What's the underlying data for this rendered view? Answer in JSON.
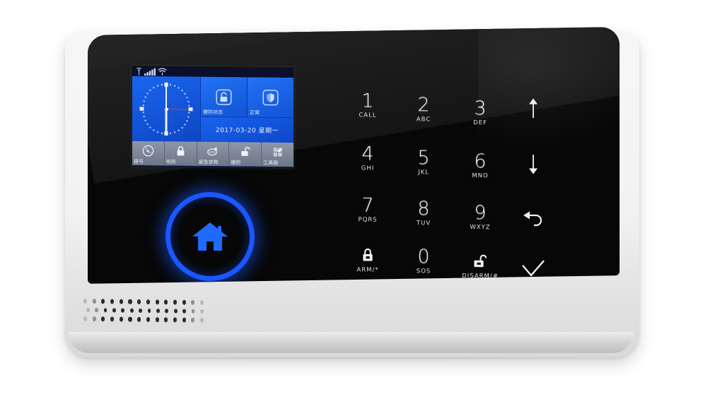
{
  "device": {
    "name": "wireless-alarm-panel",
    "colors": {
      "glass": "#070707",
      "body": "#f2f2f2",
      "accent_blue": "#1a57ff",
      "lcd_blue": "#1358e8",
      "lcd_toolbar": "#7b8496"
    }
  },
  "lcd": {
    "status_bar": {
      "antenna_icon": "antenna-icon",
      "signal_icon": "signal-bars-icon",
      "wifi_icon": "wifi-icon"
    },
    "clock": {
      "icon": "analog-clock",
      "hour_hand": "6",
      "minute_hand": "12"
    },
    "tiles": [
      {
        "icon": "unlocked-padlock-icon",
        "label": "撤防状态"
      },
      {
        "icon": "shield-icon",
        "label": "正常"
      }
    ],
    "date_line": "2017-03-20 星期一",
    "toolbar": [
      {
        "icon": "phone-dial-icon",
        "label": "拨号"
      },
      {
        "icon": "locked-padlock-icon",
        "label": "布防"
      },
      {
        "icon": "sos-icon",
        "label": "紧急求救"
      },
      {
        "icon": "unlocked-padlock-icon",
        "label": "撤防"
      },
      {
        "icon": "menu-grid-icon",
        "label": "工具箱"
      }
    ]
  },
  "home_button": {
    "icon": "home-icon",
    "label": "home"
  },
  "keypad": {
    "keys": [
      {
        "num": "1",
        "sub": "CALL"
      },
      {
        "num": "2",
        "sub": "ABC"
      },
      {
        "num": "3",
        "sub": "DEF"
      },
      {
        "num": "4",
        "sub": "GHI"
      },
      {
        "num": "5",
        "sub": "JKL"
      },
      {
        "num": "6",
        "sub": "MNO"
      },
      {
        "num": "7",
        "sub": "PQRS"
      },
      {
        "num": "8",
        "sub": "TUV"
      },
      {
        "num": "9",
        "sub": "WXYZ"
      },
      {
        "num": "0",
        "sub": "SOS"
      }
    ],
    "arm_key": {
      "icon": "locked-padlock-icon",
      "sub": "ARM/*"
    },
    "disarm_key": {
      "icon": "unlocked-padlock-icon",
      "sub": "DISARM/#"
    },
    "function_keys": [
      {
        "icon": "arrow-up-icon",
        "label": "up"
      },
      {
        "icon": "arrow-down-icon",
        "label": "down"
      },
      {
        "icon": "back-arrow-icon",
        "label": "back"
      },
      {
        "icon": "checkmark-icon",
        "label": "confirm"
      }
    ]
  },
  "speaker": {
    "label": "speaker-grille"
  }
}
